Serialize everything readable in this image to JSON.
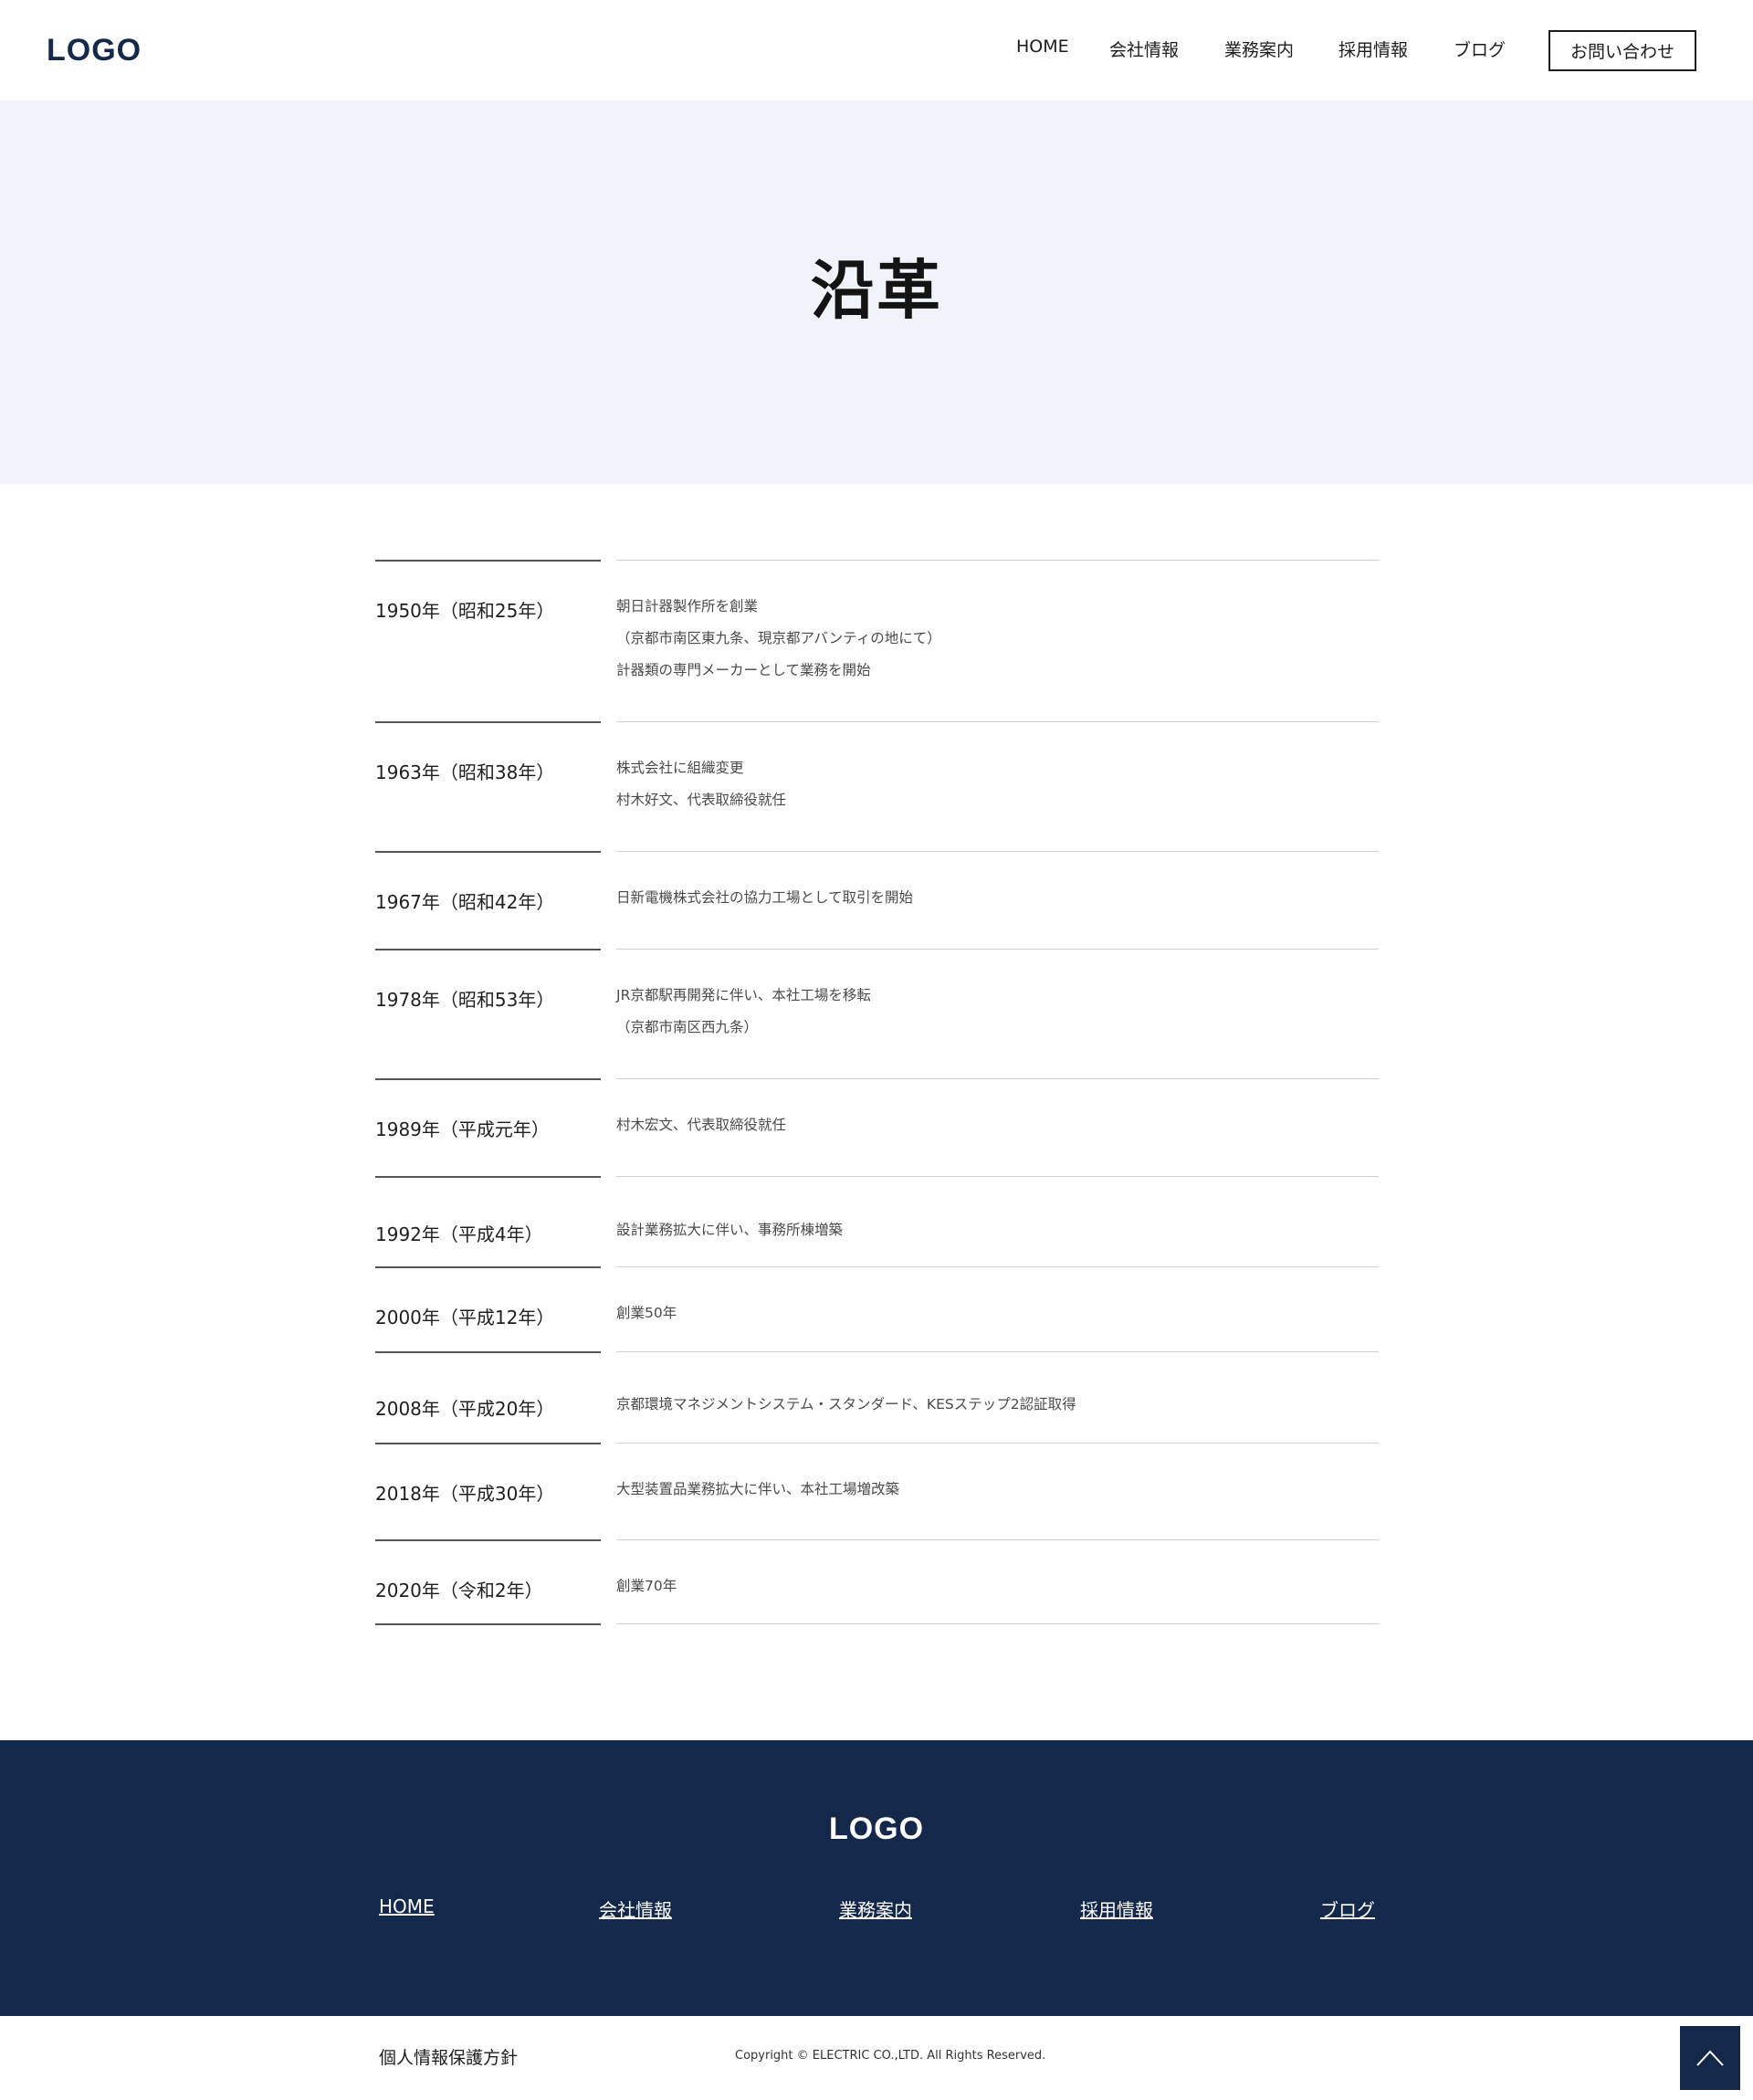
{
  "header": {
    "logo": "LOGO",
    "nav": [
      "HOME",
      "会社情報",
      "業務案内",
      "採用情報",
      "ブログ"
    ],
    "contact": "お問い合わせ"
  },
  "hero": {
    "title": "沿革"
  },
  "history": [
    {
      "year": "1950年（昭和25年）",
      "lines": [
        "朝日計器製作所を創業",
        "（京都市南区東九条、現京都アバンティの地にて）",
        "計器類の専門メーカーとして業務を開始"
      ]
    },
    {
      "year": "1963年（昭和38年）",
      "lines": [
        "株式会社に組織変更",
        "村木好文、代表取締役就任"
      ]
    },
    {
      "year": "1967年（昭和42年）",
      "lines": [
        "日新電機株式会社の協力工場として取引を開始"
      ]
    },
    {
      "year": "1978年（昭和53年）",
      "lines": [
        "JR京都駅再開発に伴い、本社工場を移転",
        "（京都市南区西九条）"
      ]
    },
    {
      "year": "1989年（平成元年）",
      "lines": [
        "村木宏文、代表取締役就任"
      ]
    },
    {
      "year": "1992年（平成4年）",
      "lines": [
        "設計業務拡大に伴い、事務所棟増築"
      ]
    },
    {
      "year": "2000年（平成12年）",
      "lines": [
        "創業50年"
      ]
    },
    {
      "year": "2008年（平成20年）",
      "lines": [
        "京都環境マネジメントシステム・スタンダード、KESステップ2認証取得"
      ]
    },
    {
      "year": "2018年（平成30年）",
      "lines": [
        "大型装置品業務拡大に伴い、本社工場増改築"
      ]
    },
    {
      "year": "2020年（令和2年）",
      "lines": [
        "創業70年"
      ]
    }
  ],
  "footer": {
    "logo": "LOGO",
    "links": [
      "HOME",
      "会社情報",
      "業務案内",
      "採用情報",
      "ブログ"
    ],
    "privacy": "個人情報保護方針",
    "copyright": "Copyright © ELECTRIC CO.,LTD. All Rights Reserved."
  }
}
